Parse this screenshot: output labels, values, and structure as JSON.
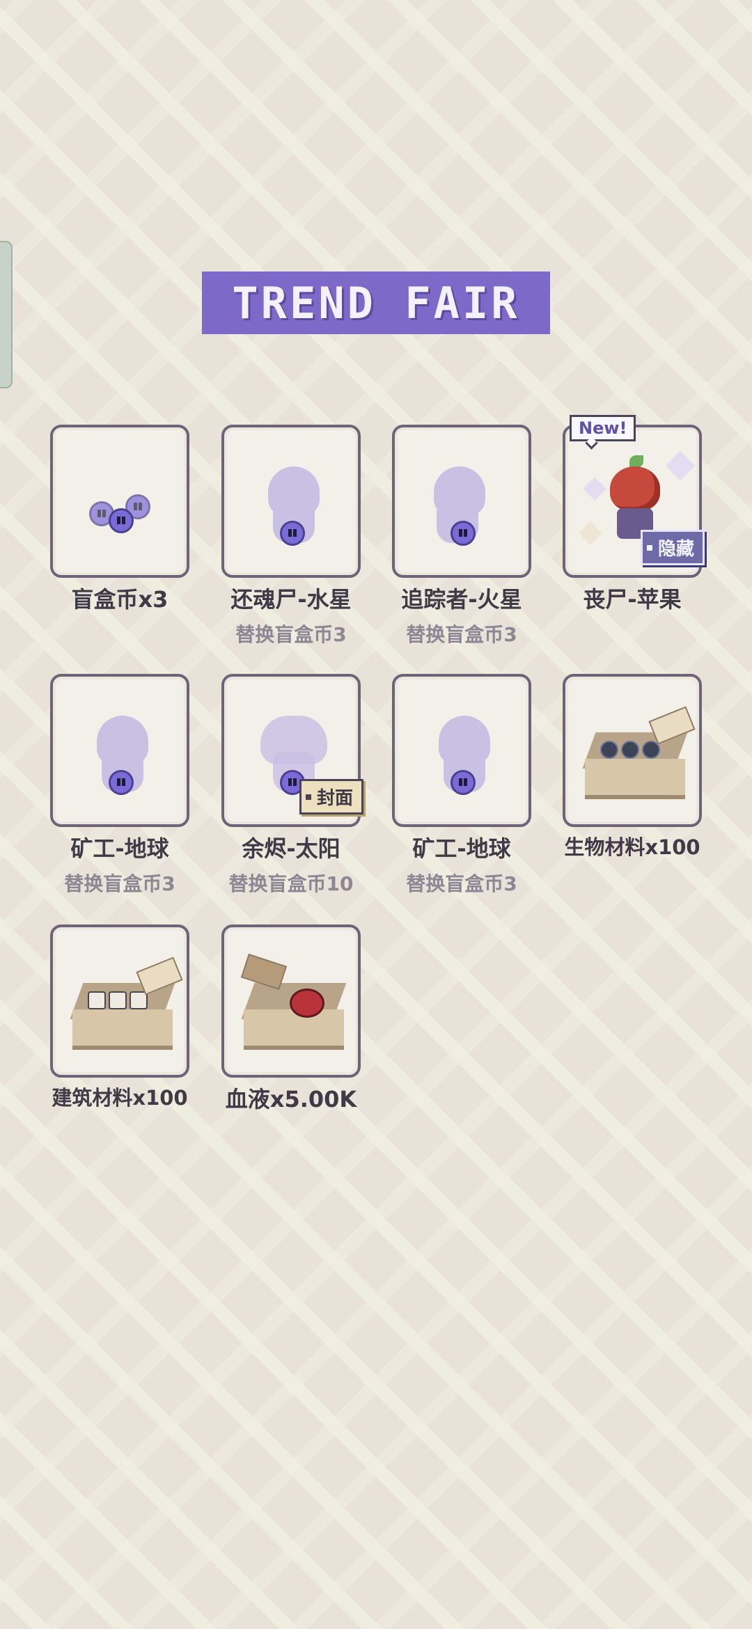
{
  "header": {
    "title": "TREND FAIR"
  },
  "items": [
    {
      "name": "盲盒币x3",
      "sub": "",
      "icon": "blind-box-coins-icon"
    },
    {
      "name": "还魂尸-水星",
      "sub": "替换盲盒币3",
      "icon": "ghost-silhouette-icon"
    },
    {
      "name": "追踪者-火星",
      "sub": "替换盲盒币3",
      "icon": "ghost-silhouette-icon"
    },
    {
      "name": "丧尸-苹果",
      "sub": "",
      "icon": "apple-zombie-icon",
      "badge": "New!",
      "tag": "隐藏"
    },
    {
      "name": "矿工-地球",
      "sub": "替换盲盒币3",
      "icon": "ghost-silhouette-icon"
    },
    {
      "name": "余烬-太阳",
      "sub": "替换盲盒币10",
      "icon": "ghost-silhouette-icon",
      "tag": "封面"
    },
    {
      "name": "矿工-地球",
      "sub": "替换盲盒币3",
      "icon": "ghost-silhouette-icon"
    },
    {
      "name": "生物材料x100",
      "sub": "",
      "icon": "bio-material-crate-icon"
    },
    {
      "name": "建筑材料x100",
      "sub": "",
      "icon": "building-material-crate-icon"
    },
    {
      "name": "血液x5.00K",
      "sub": "",
      "icon": "blood-crate-icon"
    }
  ],
  "colors": {
    "banner": "#7d6ac8",
    "card_border": "#6e6478",
    "coin": "#7a6bd6",
    "silhouette": "#c9c1e4"
  }
}
